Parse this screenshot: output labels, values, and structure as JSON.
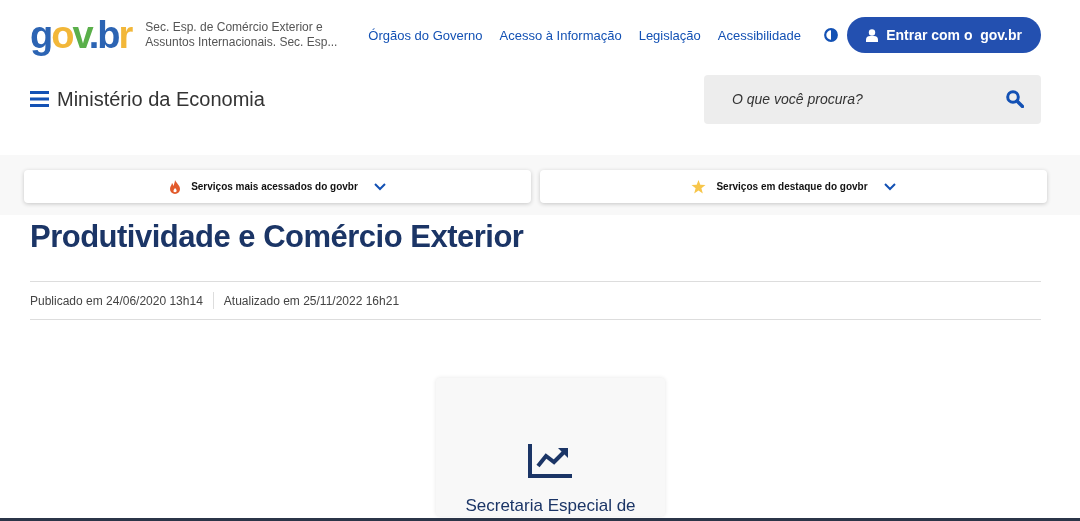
{
  "header": {
    "logo": "gov.br",
    "org_name": "Sec. Esp. de Comércio Exterior e Assuntos Internacionais. Sec. Esp...",
    "links": [
      "Órgãos do Governo",
      "Acesso à Informação",
      "Legislação",
      "Acessibilidade"
    ],
    "login_button": "Entrar com o  gov.br",
    "site_title": "Ministério da Economia",
    "search": {
      "placeholder": "O que você procura?"
    }
  },
  "services": [
    {
      "label": "Serviços mais acessados do govbr",
      "kind": "flame"
    },
    {
      "label": "Serviços em destaque do govbr",
      "kind": "star"
    }
  ],
  "article": {
    "title": "Produtividade e Comércio Exterior",
    "published": "Publicado em 24/06/2020 13h14",
    "updated": "Atualizado em 25/11/2022 16h21",
    "cards": [
      {
        "title": "Secretaria Especial de",
        "kind": "chart"
      }
    ]
  }
}
